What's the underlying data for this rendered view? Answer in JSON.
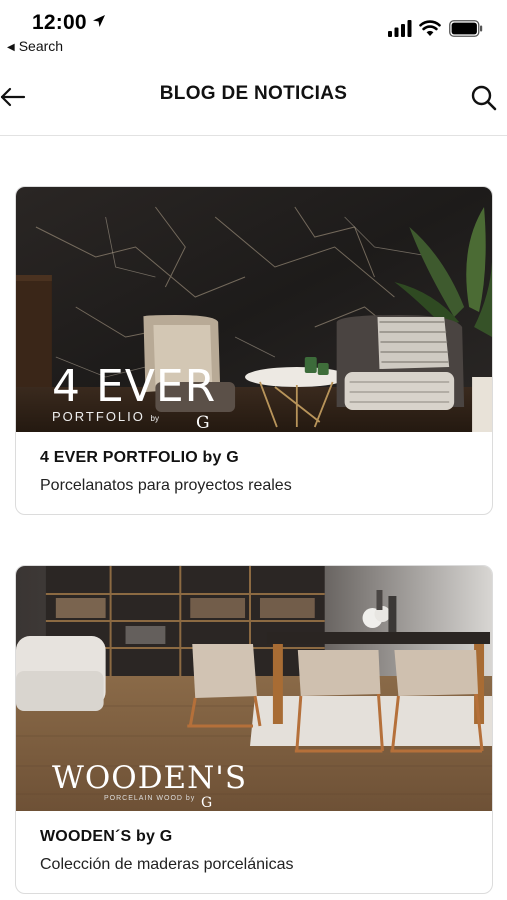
{
  "status_bar": {
    "time": "12:00",
    "back_app_label": "Search"
  },
  "nav": {
    "title": "BLOG DE NOTICIAS",
    "back_icon": "arrow-left-icon",
    "search_icon": "search-icon"
  },
  "posts": [
    {
      "title": "4 EVER PORTFOLIO by G",
      "subtitle": "Porcelanatos para proyectos reales",
      "brand_main": "4 EVER",
      "brand_sub": "PORTFOLIO",
      "brand_by": "by",
      "brand_g": "G"
    },
    {
      "title": "WOODEN´S by G",
      "subtitle": "Colección de maderas porcelánicas",
      "brand_main": "WOODEN'S",
      "brand_sub": "PORCELAIN WOOD by",
      "brand_g": "G"
    }
  ],
  "colors": {
    "text": "#111111",
    "divider": "#e2e2e2",
    "card_border": "#dcdcdc"
  }
}
